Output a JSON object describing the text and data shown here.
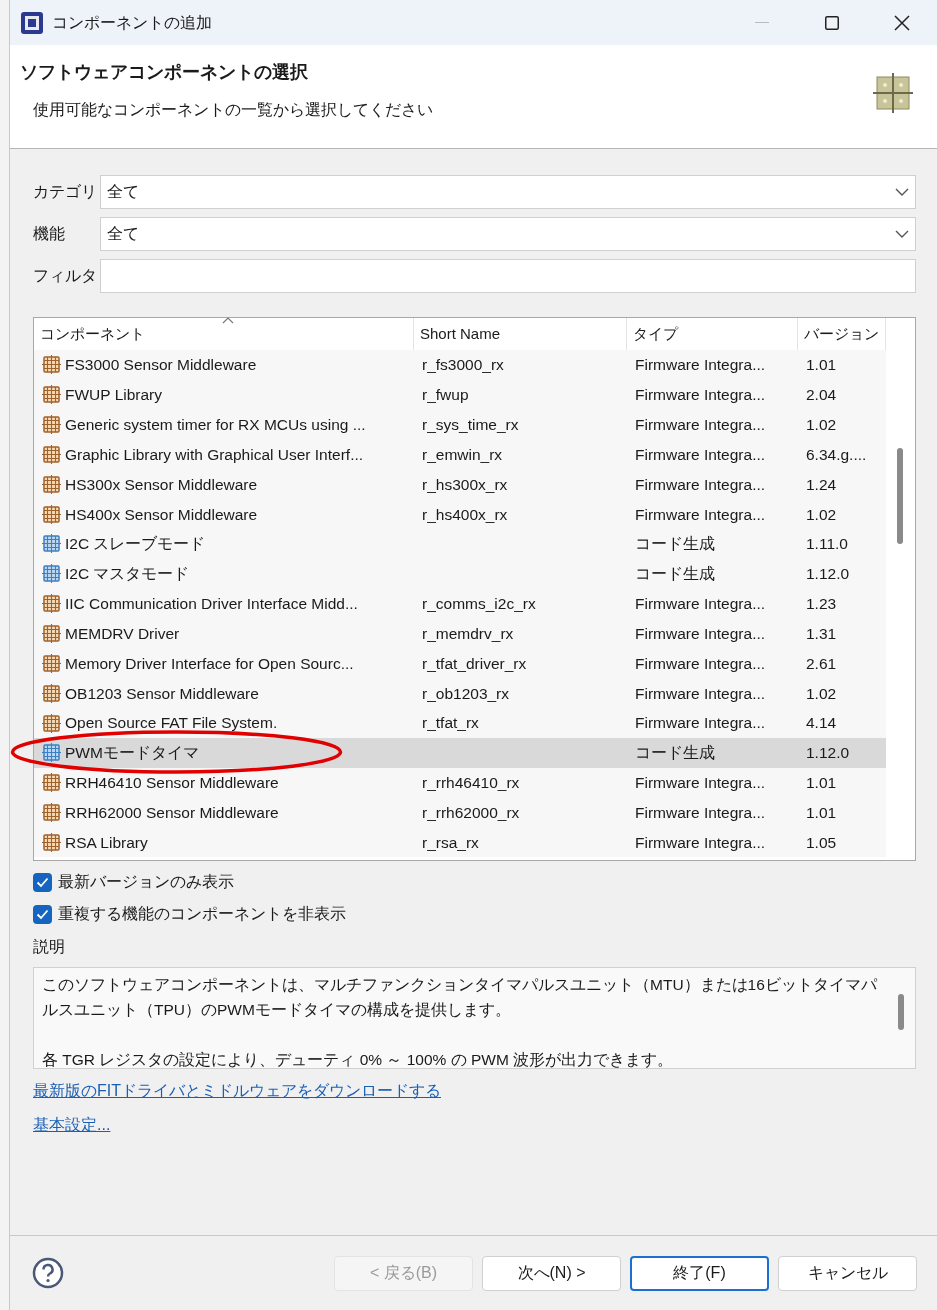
{
  "window": {
    "title": "コンポーネントの追加"
  },
  "header": {
    "title": "ソフトウェアコンポーネントの選択",
    "subtitle": "使用可能なコンポーネントの一覧から選択してください"
  },
  "fields": [
    {
      "kind": "select",
      "label": "カテゴリ",
      "value": "全て"
    },
    {
      "kind": "select",
      "label": "機能",
      "value": "全て"
    },
    {
      "kind": "text",
      "label": "フィルタ"
    }
  ],
  "table": {
    "columns": [
      "コンポーネント",
      "Short Name",
      "タイプ",
      "バージョン"
    ],
    "rows": [
      {
        "kind": "fit",
        "selected": false,
        "component": "FS3000 Sensor Middleware",
        "short_name": "r_fs3000_rx",
        "type": "Firmware Integra...",
        "version": "1.01"
      },
      {
        "kind": "fit",
        "selected": false,
        "component": "FWUP Library",
        "short_name": "r_fwup",
        "type": "Firmware Integra...",
        "version": "2.04"
      },
      {
        "kind": "fit",
        "selected": false,
        "component": "Generic system timer for RX MCUs using ...",
        "short_name": "r_sys_time_rx",
        "type": "Firmware Integra...",
        "version": "1.02"
      },
      {
        "kind": "fit",
        "selected": false,
        "component": "Graphic Library with Graphical User Interf...",
        "short_name": "r_emwin_rx",
        "type": "Firmware Integra...",
        "version": "6.34.g...."
      },
      {
        "kind": "fit",
        "selected": false,
        "component": "HS300x Sensor Middleware",
        "short_name": "r_hs300x_rx",
        "type": "Firmware Integra...",
        "version": "1.24"
      },
      {
        "kind": "fit",
        "selected": false,
        "component": "HS400x Sensor Middleware",
        "short_name": "r_hs400x_rx",
        "type": "Firmware Integra...",
        "version": "1.02"
      },
      {
        "kind": "codegen",
        "selected": false,
        "component": "I2C スレーブモード",
        "type": "コード生成",
        "version": "1.11.0"
      },
      {
        "kind": "codegen",
        "selected": false,
        "component": "I2C マスタモード",
        "type": "コード生成",
        "version": "1.12.0"
      },
      {
        "kind": "fit",
        "selected": false,
        "component": "IIC Communication Driver Interface Midd...",
        "short_name": "r_comms_i2c_rx",
        "type": "Firmware Integra...",
        "version": "1.23"
      },
      {
        "kind": "fit",
        "selected": false,
        "component": "MEMDRV Driver",
        "short_name": "r_memdrv_rx",
        "type": "Firmware Integra...",
        "version": "1.31"
      },
      {
        "kind": "fit",
        "selected": false,
        "component": "Memory Driver Interface for Open Sourc...",
        "short_name": "r_tfat_driver_rx",
        "type": "Firmware Integra...",
        "version": "2.61"
      },
      {
        "kind": "fit",
        "selected": false,
        "component": "OB1203 Sensor Middleware",
        "short_name": "r_ob1203_rx",
        "type": "Firmware Integra...",
        "version": "1.02"
      },
      {
        "kind": "fit",
        "selected": false,
        "component": "Open Source FAT File System.",
        "short_name": "r_tfat_rx",
        "type": "Firmware Integra...",
        "version": "4.14"
      },
      {
        "kind": "codegen",
        "selected": true,
        "component": "PWMモードタイマ",
        "type": "コード生成",
        "version": "1.12.0"
      },
      {
        "kind": "fit",
        "selected": false,
        "component": "RRH46410 Sensor Middleware",
        "short_name": "r_rrh46410_rx",
        "type": "Firmware Integra...",
        "version": "1.01"
      },
      {
        "kind": "fit",
        "selected": false,
        "component": "RRH62000 Sensor Middleware",
        "short_name": "r_rrh62000_rx",
        "type": "Firmware Integra...",
        "version": "1.01"
      },
      {
        "kind": "fit",
        "selected": false,
        "component": "RSA Library",
        "short_name": "r_rsa_rx",
        "type": "Firmware Integra...",
        "version": "1.05"
      }
    ]
  },
  "options": [
    {
      "label": "最新バージョンのみ表示",
      "checked": true
    },
    {
      "label": "重複する機能のコンポーネントを非表示",
      "checked": true
    }
  ],
  "description": {
    "label": "説明",
    "paragraphs": [
      "このソフトウェアコンポーネントは、マルチファンクションタイマパルスユニット（MTU）または16ビットタイマパルスユニット（TPU）のPWMモードタイマの構成を提供します。",
      "各 TGR レジスタの設定により、デューティ 0% ～ 100% の PWM 波形が出力できます。"
    ]
  },
  "links": [
    "最新版のFITドライバとミドルウェアをダウンロードする",
    "基本設定..."
  ],
  "buttons": [
    {
      "label": "< 戻る(B)",
      "disabled": true,
      "default": false
    },
    {
      "label": "次へ(N) >",
      "disabled": false,
      "default": false
    },
    {
      "label": "終了(F)",
      "disabled": false,
      "default": true
    },
    {
      "label": "キャンセル",
      "disabled": false,
      "default": false
    }
  ]
}
